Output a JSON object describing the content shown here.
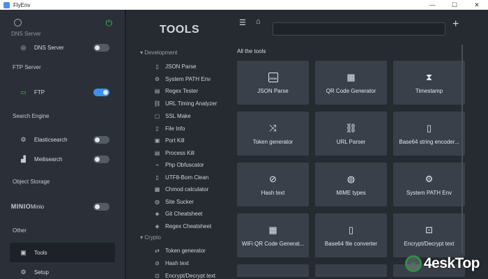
{
  "window": {
    "title": "FlyEnv",
    "controls": [
      "—",
      "☐",
      "✕"
    ]
  },
  "sidebar": {
    "ghost_label": "DNS Server",
    "items": [
      {
        "type": "item",
        "label": "DNS Server",
        "icon": "dns-icon",
        "toggle": "off"
      },
      {
        "type": "section",
        "label": "FTP Server"
      },
      {
        "type": "item",
        "label": "FTP",
        "icon": "ftp-folder-icon",
        "toggle": "on"
      },
      {
        "type": "section",
        "label": "Search Engine"
      },
      {
        "type": "item",
        "label": "Elasticsearch",
        "icon": "elasticsearch-icon",
        "toggle": "off"
      },
      {
        "type": "item",
        "label": "Meilisearch",
        "icon": "meilisearch-icon",
        "toggle": "off"
      },
      {
        "type": "section",
        "label": "Object Storage"
      },
      {
        "type": "item",
        "label": "Minio",
        "icon": "minio-icon",
        "icon_text": "MINIO",
        "toggle": "off"
      },
      {
        "type": "section",
        "label": "Other"
      },
      {
        "type": "item",
        "label": "Tools",
        "icon": "toolbox-icon",
        "active": true
      },
      {
        "type": "item",
        "label": "Setup",
        "icon": "setup-icon"
      }
    ]
  },
  "toolslist": {
    "heading": "TOOLS",
    "groups": [
      {
        "label": "Development",
        "items": [
          "JSON Parse",
          "System PATH Env",
          "Regex Tester",
          "URL Timing Analyzer",
          "SSL Make",
          "File Info",
          "Port Kill",
          "Process Kill",
          "Php Obfuscator",
          "UTF8-Bom Clean",
          "Chmod calculator",
          "Site Sucker",
          "Git Cheatsheet",
          "Regex Cheatsheet"
        ]
      },
      {
        "label": "Crypto",
        "items": [
          "Token generator",
          "Hash text",
          "Encrypt/Decrypt text"
        ]
      }
    ]
  },
  "main": {
    "search_value": "",
    "all_tools_label": "All the tools",
    "cards": [
      {
        "label": "JSON Parse",
        "icon": "json-file-icon"
      },
      {
        "label": "QR Code Generator",
        "icon": "qr-code-icon"
      },
      {
        "label": "Timestamp",
        "icon": "hourglass-icon"
      },
      {
        "label": "Token generator",
        "icon": "shuffle-icon"
      },
      {
        "label": "URL Parser",
        "icon": "unlink-icon"
      },
      {
        "label": "Base64 string encoder...",
        "icon": "base64-file-icon"
      },
      {
        "label": "Hash text",
        "icon": "eye-off-icon"
      },
      {
        "label": "MIME types",
        "icon": "globe-icon"
      },
      {
        "label": "System PATH Env",
        "icon": "settings-code-icon"
      },
      {
        "label": "WiFi QR Code Generat...",
        "icon": "qr-code-icon"
      },
      {
        "label": "Base64 file converter",
        "icon": "base64-file-icon"
      },
      {
        "label": "Encrypt/Decrypt text",
        "icon": "lock-icon"
      }
    ]
  },
  "watermark": {
    "text": "4eskTop",
    "logo_text": "◎"
  },
  "colors": {
    "accent": "#3d8ef0",
    "power": "#3fbf5c",
    "card": "#3a404a"
  }
}
